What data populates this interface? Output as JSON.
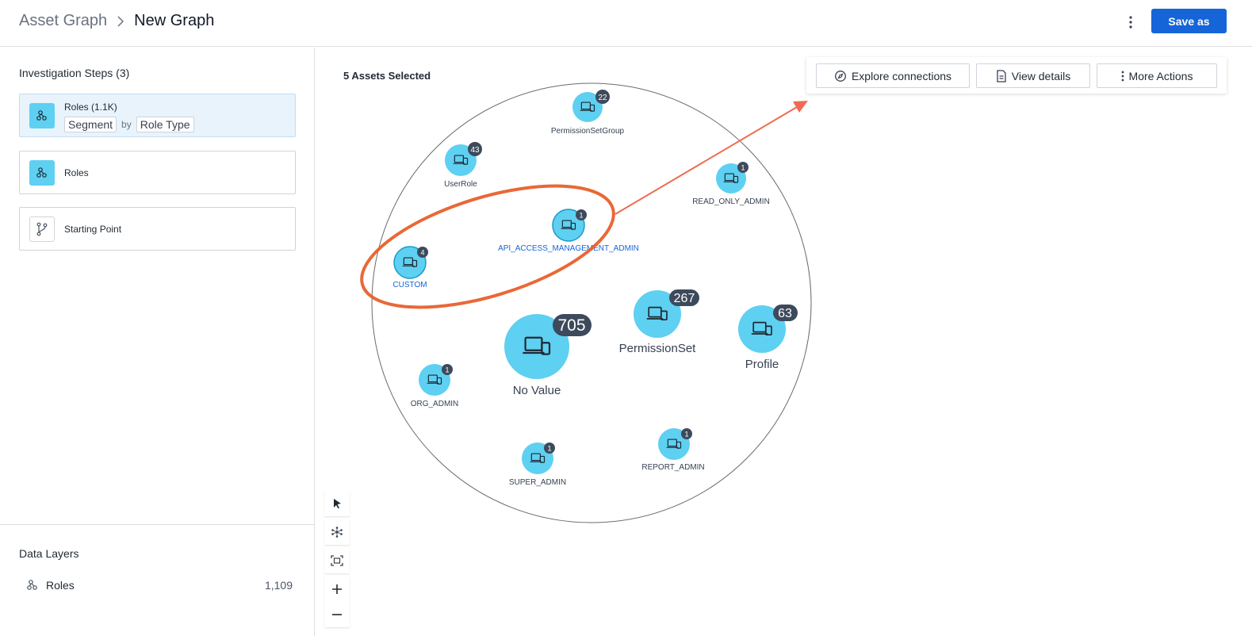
{
  "header": {
    "breadcrumb_root": "Asset Graph",
    "breadcrumb_current": "New Graph",
    "save_label": "Save as"
  },
  "sidebar": {
    "steps_title": "Investigation Steps (3)",
    "steps": [
      {
        "label": "Roles (1.1K)",
        "segment_chip": "Segment",
        "by_text": "by",
        "type_chip": "Role Type",
        "icon": "roles-icon"
      },
      {
        "label": "Roles",
        "icon": "roles-icon"
      },
      {
        "label": "Starting Point",
        "icon": "branch-icon"
      }
    ],
    "layers_title": "Data Layers",
    "layers": [
      {
        "label": "Roles",
        "count": "1,109",
        "icon": "roles-icon"
      }
    ]
  },
  "graph": {
    "selected_text": "5 Assets Selected",
    "actions": {
      "explore": "Explore connections",
      "details": "View details",
      "more": "More Actions"
    },
    "nodes": [
      {
        "label": "PermissionSetGroup",
        "count": "22",
        "selected": false
      },
      {
        "label": "UserRole",
        "count": "43",
        "selected": false
      },
      {
        "label": "READ_ONLY_ADMIN",
        "count": "1",
        "selected": false
      },
      {
        "label": "API_ACCESS_MANAGEMENT_ADMIN",
        "count": "1",
        "selected": true
      },
      {
        "label": "CUSTOM",
        "count": "4",
        "selected": true
      },
      {
        "label": "PermissionSet",
        "count": "267",
        "selected": false
      },
      {
        "label": "Profile",
        "count": "63",
        "selected": false
      },
      {
        "label": "No Value",
        "count": "705",
        "selected": false
      },
      {
        "label": "ORG_ADMIN",
        "count": "1",
        "selected": false
      },
      {
        "label": "SUPER_ADMIN",
        "count": "1",
        "selected": false
      },
      {
        "label": "REPORT_ADMIN",
        "count": "1",
        "selected": false
      }
    ]
  },
  "colors": {
    "accent": "#1565d8",
    "node_fill": "#5ed0f1",
    "badge": "#3d4a5c",
    "selected_label": "#1565d8",
    "annotation": "#e8602c"
  }
}
